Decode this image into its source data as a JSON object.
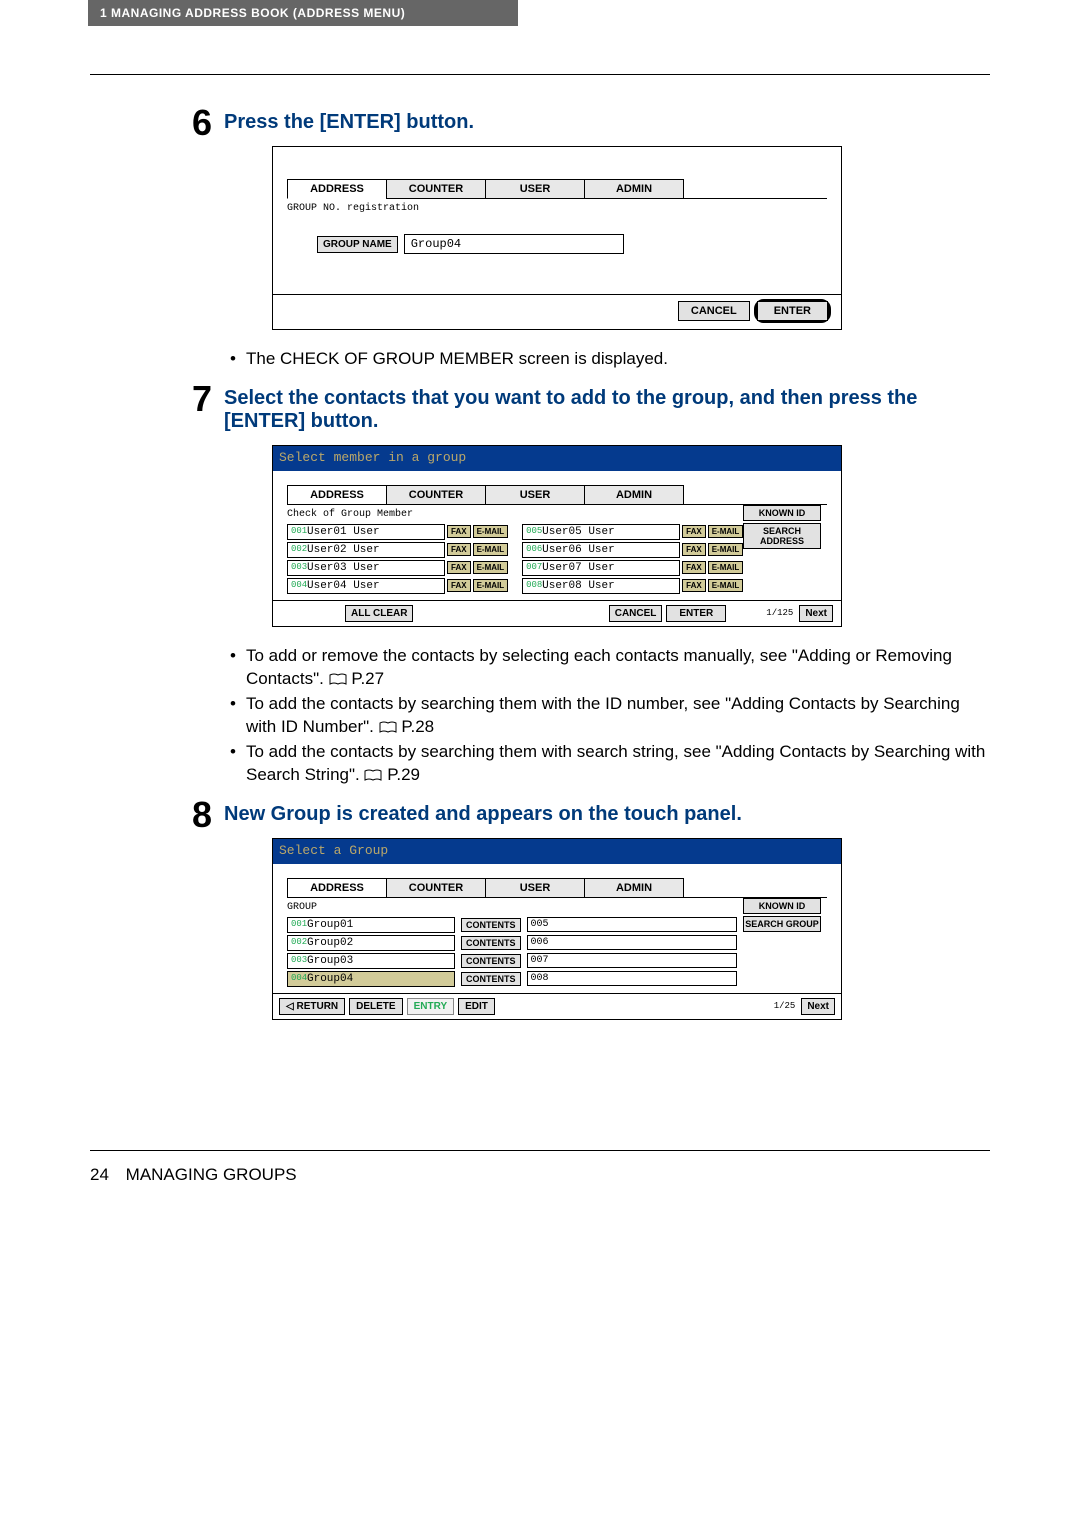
{
  "header": {
    "breadcrumb": "1   MANAGING ADDRESS BOOK (ADDRESS MENU)"
  },
  "steps": {
    "s6": {
      "num": "6",
      "title": "Press the [ENTER] button.",
      "after_bullet": "The CHECK OF GROUP MEMBER screen is displayed."
    },
    "s7": {
      "num": "7",
      "title": "Select the contacts that you want to add to the group, and then press the [ENTER] button.",
      "b1a": "To add or remove the contacts by selecting each contacts manually, see \"Adding or Removing Contacts\". ",
      "b1p": " P.27",
      "b2a": "To add the contacts by searching them with the ID number, see \"Adding Contacts by Searching with ID Number\". ",
      "b2p": " P.28",
      "b3a": "To add the contacts by searching them with search string, see \"Adding Contacts by Searching with Search String\". ",
      "b3p": " P.29"
    },
    "s8": {
      "num": "8",
      "title": "New Group is created and appears on the touch panel."
    }
  },
  "screen1": {
    "tabs": {
      "address": "ADDRESS",
      "counter": "COUNTER",
      "user": "USER",
      "admin": "ADMIN"
    },
    "subtitle": "GROUP NO. registration",
    "group_name_btn": "GROUP NAME",
    "group_name_value": "Group04",
    "cancel": "CANCEL",
    "enter": "ENTER"
  },
  "screen2": {
    "title": "Select member in a group",
    "tabs": {
      "address": "ADDRESS",
      "counter": "COUNTER",
      "user": "USER",
      "admin": "ADMIN"
    },
    "subtitle": "Check of Group Member",
    "known_id": "KNOWN ID",
    "search_addr": "SEARCH ADDRESS",
    "fax": "FAX",
    "email": "E-MAIL",
    "rows": [
      {
        "lid": "001",
        "lname": "User01 User",
        "rid": "005",
        "rname": "User05 User"
      },
      {
        "lid": "002",
        "lname": "User02 User",
        "rid": "006",
        "rname": "User06 User"
      },
      {
        "lid": "003",
        "lname": "User03 User",
        "rid": "007",
        "rname": "User07 User"
      },
      {
        "lid": "004",
        "lname": "User04 User",
        "rid": "008",
        "rname": "User08 User"
      }
    ],
    "all_clear": "ALL CLEAR",
    "cancel": "CANCEL",
    "enter": "ENTER",
    "pager": "1/125",
    "next": "Next"
  },
  "screen3": {
    "title": "Select a Group",
    "tabs": {
      "address": "ADDRESS",
      "counter": "COUNTER",
      "user": "USER",
      "admin": "ADMIN"
    },
    "section": "GROUP",
    "known_id": "KNOWN ID",
    "search_group": "SEARCH GROUP",
    "contents": "CONTENTS",
    "rows": [
      {
        "lid": "001",
        "lname": "Group01",
        "rid": "005",
        "sel": false
      },
      {
        "lid": "002",
        "lname": "Group02",
        "rid": "006",
        "sel": false
      },
      {
        "lid": "003",
        "lname": "Group03",
        "rid": "007",
        "sel": false
      },
      {
        "lid": "004",
        "lname": "Group04",
        "rid": "008",
        "sel": true
      }
    ],
    "return": "RETURN",
    "delete": "DELETE",
    "entry": "ENTRY",
    "edit": "EDIT",
    "pager": "1/25",
    "next": "Next"
  },
  "footer": {
    "page": "24",
    "title": "MANAGING GROUPS"
  }
}
